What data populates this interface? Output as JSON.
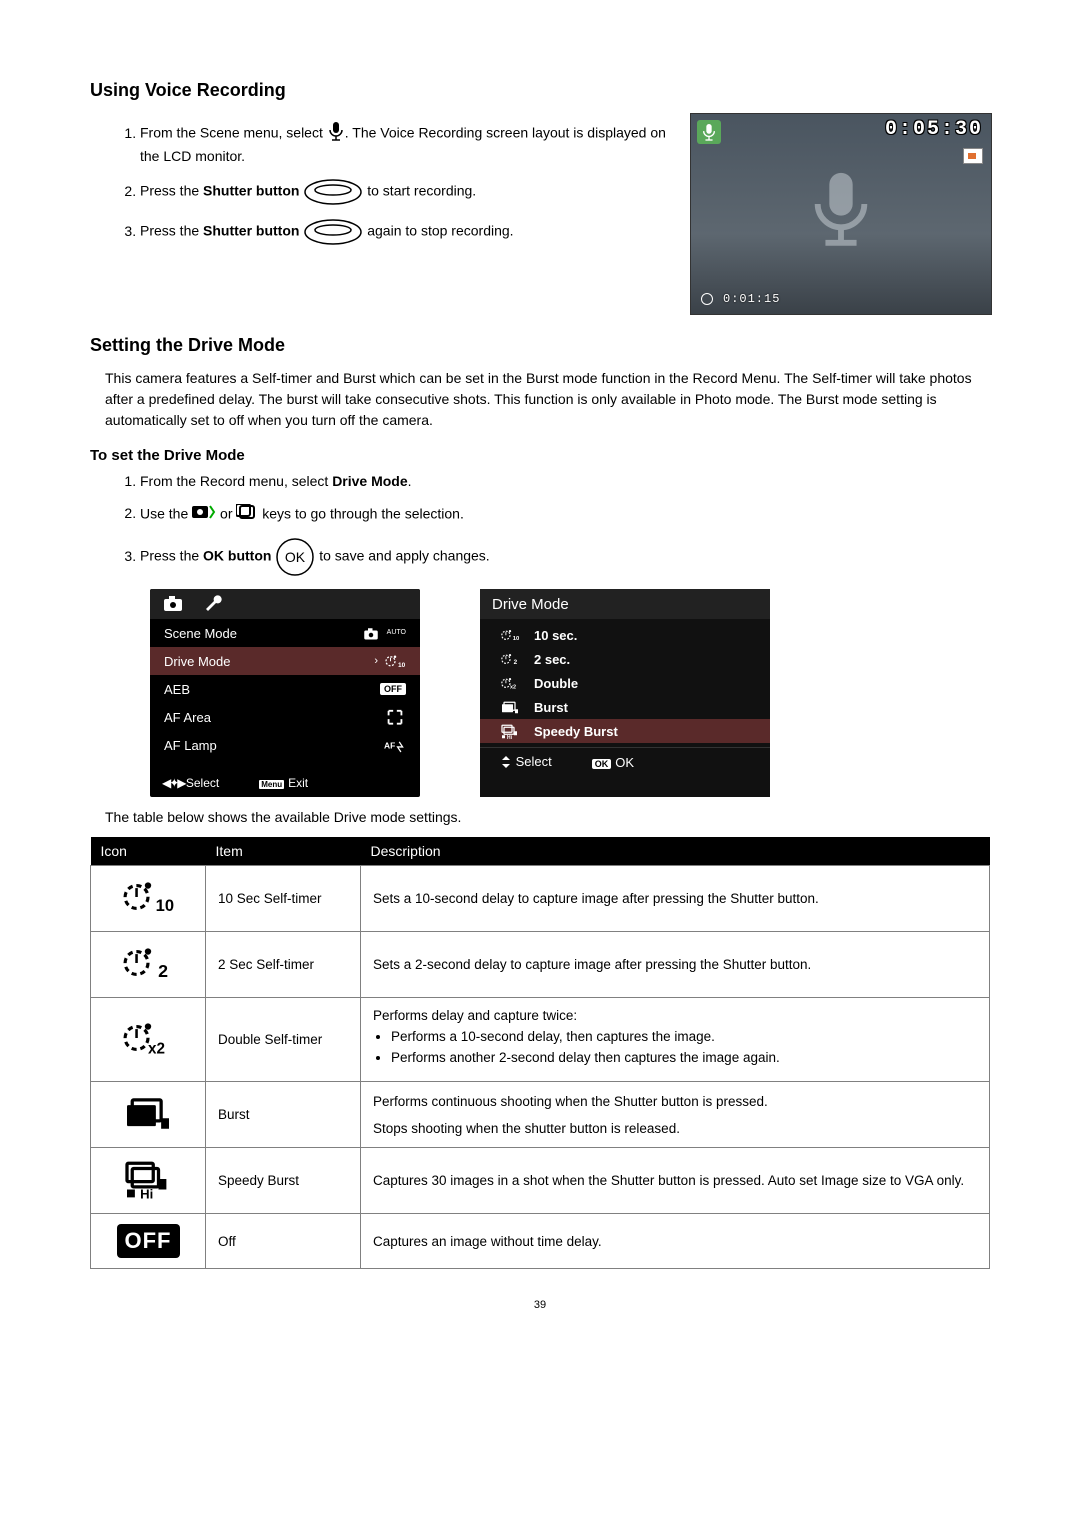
{
  "sections": {
    "voice": {
      "title": "Using Voice Recording",
      "steps": [
        {
          "pre": "From the Scene menu, select ",
          "post": ". The Voice Recording screen layout is displayed on the LCD monitor."
        },
        {
          "pre": "Press the ",
          "bold": "Shutter button",
          "post": " to start recording."
        },
        {
          "pre": "Press the ",
          "bold": "Shutter button",
          "post": " again to stop recording."
        }
      ],
      "lcd": {
        "timer": "0:05:30",
        "elapsed": "0:01:15"
      }
    },
    "drive": {
      "title": "Setting the Drive Mode",
      "para": "This camera features a Self-timer and Burst which can be set in the Burst mode function in the Record Menu. The Self-timer will take photos after a predefined delay. The burst will take consecutive shots. This function is only available in Photo mode. The Burst mode setting is automatically set to off when you turn off the camera.",
      "sub": "To set the Drive Mode",
      "steps": [
        {
          "pre": "From the Record menu, select ",
          "bold": "Drive Mode",
          "post": "."
        },
        {
          "pre": "Use the ",
          "post": " keys to go through the selection."
        },
        {
          "pre": "Press the ",
          "bold": "OK button",
          "post": " to save and apply changes."
        }
      ],
      "menu1": {
        "rows": [
          {
            "label": "Scene Mode",
            "val_icon": "camera-auto"
          },
          {
            "label": "Drive Mode",
            "val_icon": "timer10",
            "selected": true,
            "arrow": true
          },
          {
            "label": "AEB",
            "val_text": "OFF"
          },
          {
            "label": "AF Area",
            "val_icon": "af-area"
          },
          {
            "label": "AF Lamp",
            "val_icon": "af-lamp"
          }
        ],
        "foot_select": "Select",
        "foot_exit": "Exit",
        "foot_exit_badge": "Menu"
      },
      "menu2": {
        "title": "Drive Mode",
        "items": [
          {
            "icon": "timer10",
            "label": "10 sec."
          },
          {
            "icon": "timer2",
            "label": "2 sec."
          },
          {
            "icon": "timerx2",
            "label": "Double"
          },
          {
            "icon": "burst",
            "label": "Burst"
          },
          {
            "icon": "speedy",
            "label": "Speedy  Burst",
            "selected": true
          }
        ],
        "foot_select": "Select",
        "foot_ok_badge": "OK",
        "foot_ok": "OK"
      },
      "table_intro": "The table below shows the available Drive mode settings.",
      "table_headers": [
        "Icon",
        "Item",
        "Description"
      ],
      "table_rows": [
        {
          "icon": "timer10",
          "item": "10 Sec Self-timer",
          "desc": "Sets a 10-second delay to capture image after pressing the Shutter button."
        },
        {
          "icon": "timer2",
          "item": "2 Sec Self-timer",
          "desc": "Sets a 2-second delay to capture image after pressing the Shutter button."
        },
        {
          "icon": "timerx2",
          "item": "Double Self-timer",
          "desc": "Performs delay and capture twice:",
          "bullets": [
            "Performs a 10-second delay, then captures the image.",
            "Performs another 2-second delay then captures the image again."
          ]
        },
        {
          "icon": "burst",
          "item": "Burst",
          "desc": "Performs continuous shooting when the Shutter button is pressed.",
          "desc2": "Stops shooting when the shutter button is released."
        },
        {
          "icon": "speedy",
          "item": "Speedy Burst",
          "desc": "Captures 30 images in a shot when the Shutter button is pressed. Auto set Image size to VGA only."
        },
        {
          "icon": "off",
          "item": "Off",
          "desc": "Captures an image without time delay."
        }
      ]
    }
  },
  "labels": {
    "or": " or "
  },
  "page_number": "39"
}
